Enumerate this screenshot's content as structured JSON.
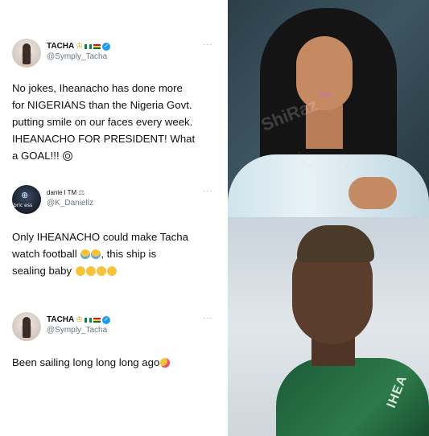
{
  "tweets": [
    {
      "display_name": "TACHA",
      "handle": "@Symply_Tacha",
      "more": "···",
      "lines": [
        "No jokes, Iheanacho has done more",
        "for NIGERIANS than the Nigeria Govt.",
        "putting smile on our faces every week.",
        "IHEANACHO FOR PRESIDENT! What",
        "a GOAL!!!"
      ],
      "icons": [
        "crown-icon",
        "nigeria-flag-icon",
        "ghana-flag-icon",
        "verified-icon",
        "soccer-ball-emoji"
      ]
    },
    {
      "display_name": "danie l TM",
      "handle": "@K_Daniellz",
      "more": "···",
      "avatar_text": "bric ess",
      "lines": [
        "Only IHEANACHO could make Tacha",
        "watch football",
        ", this ship is",
        "sealing baby"
      ],
      "icons": [
        "scales-icon",
        "joy-emoji",
        "smirk-emoji"
      ]
    },
    {
      "display_name": "TACHA",
      "handle": "@Symply_Tacha",
      "more": "···",
      "lines": [
        "Been sailing long long long ago"
      ],
      "icons": [
        "crown-icon",
        "nigeria-flag-icon",
        "ghana-flag-icon",
        "verified-icon",
        "smiling-hearts-emoji"
      ]
    }
  ],
  "photos": {
    "top_watermark": "ShiRaz",
    "bottom_jersey_text": "IHEA"
  },
  "colors": {
    "verified": "#1d9bf0",
    "handle": "#6b7680",
    "text": "#111111"
  }
}
